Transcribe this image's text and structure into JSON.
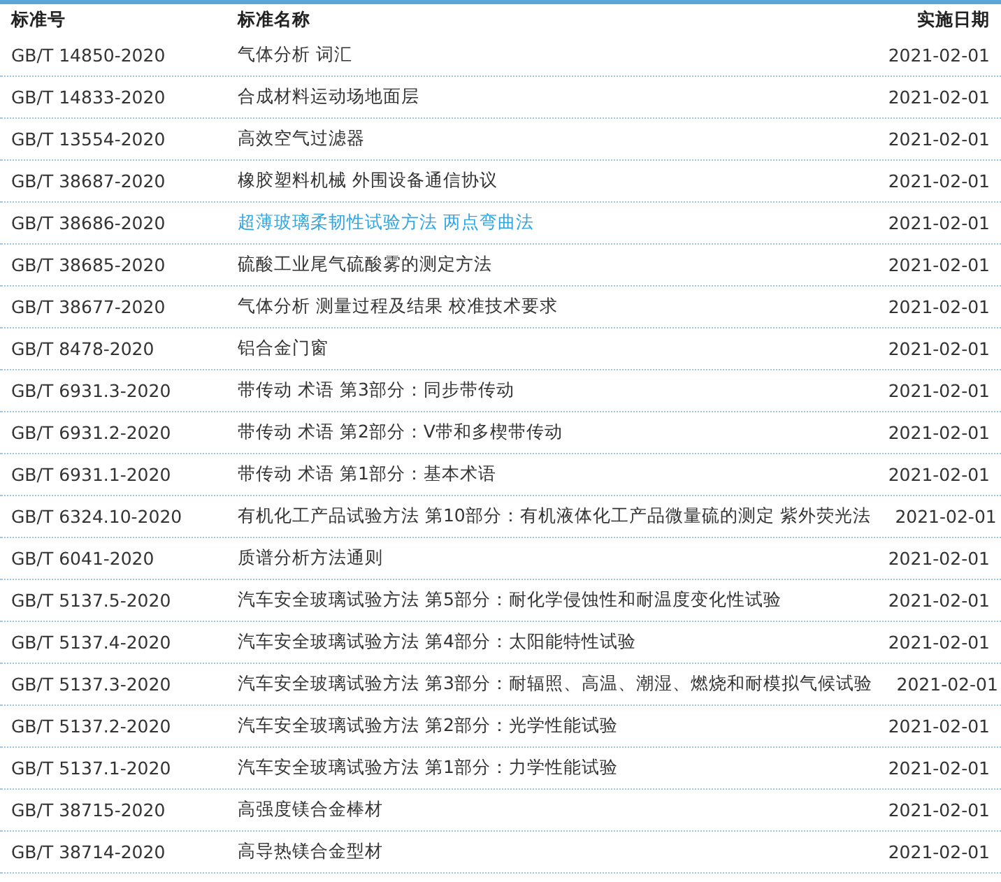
{
  "table": {
    "columns": [
      "标准号",
      "标准名称",
      "实施日期"
    ],
    "rows": [
      {
        "code": "GB/T 14850-2020",
        "name": "气体分析 词汇",
        "date": "2021-02-01",
        "hovered": false
      },
      {
        "code": "GB/T 14833-2020",
        "name": "合成材料运动场地面层",
        "date": "2021-02-01",
        "hovered": false
      },
      {
        "code": "GB/T 13554-2020",
        "name": "高效空气过滤器",
        "date": "2021-02-01",
        "hovered": false
      },
      {
        "code": "GB/T 38687-2020",
        "name": "橡胶塑料机械 外围设备通信协议",
        "date": "2021-02-01",
        "hovered": false
      },
      {
        "code": "GB/T 38686-2020",
        "name": "超薄玻璃柔韧性试验方法 两点弯曲法",
        "date": "2021-02-01",
        "hovered": true
      },
      {
        "code": "GB/T 38685-2020",
        "name": "硫酸工业尾气硫酸雾的测定方法",
        "date": "2021-02-01",
        "hovered": false
      },
      {
        "code": "GB/T 38677-2020",
        "name": "气体分析 测量过程及结果 校准技术要求",
        "date": "2021-02-01",
        "hovered": false
      },
      {
        "code": "GB/T 8478-2020",
        "name": "铝合金门窗",
        "date": "2021-02-01",
        "hovered": false
      },
      {
        "code": "GB/T 6931.3-2020",
        "name": "带传动 术语 第3部分：同步带传动",
        "date": "2021-02-01",
        "hovered": false
      },
      {
        "code": "GB/T 6931.2-2020",
        "name": "带传动 术语 第2部分：V带和多楔带传动",
        "date": "2021-02-01",
        "hovered": false
      },
      {
        "code": "GB/T 6931.1-2020",
        "name": "带传动 术语 第1部分：基本术语",
        "date": "2021-02-01",
        "hovered": false
      },
      {
        "code": "GB/T 6324.10-2020",
        "name": "有机化工产品试验方法 第10部分：有机液体化工产品微量硫的测定 紫外荧光法",
        "date": "2021-02-01",
        "hovered": false
      },
      {
        "code": "GB/T 6041-2020",
        "name": "质谱分析方法通则",
        "date": "2021-02-01",
        "hovered": false
      },
      {
        "code": "GB/T 5137.5-2020",
        "name": "汽车安全玻璃试验方法 第5部分：耐化学侵蚀性和耐温度变化性试验",
        "date": "2021-02-01",
        "hovered": false
      },
      {
        "code": "GB/T 5137.4-2020",
        "name": "汽车安全玻璃试验方法 第4部分：太阳能特性试验",
        "date": "2021-02-01",
        "hovered": false
      },
      {
        "code": "GB/T 5137.3-2020",
        "name": "汽车安全玻璃试验方法 第3部分：耐辐照、高温、潮湿、燃烧和耐模拟气候试验",
        "date": "2021-02-01",
        "hovered": false
      },
      {
        "code": "GB/T 5137.2-2020",
        "name": "汽车安全玻璃试验方法 第2部分：光学性能试验",
        "date": "2021-02-01",
        "hovered": false
      },
      {
        "code": "GB/T 5137.1-2020",
        "name": "汽车安全玻璃试验方法 第1部分：力学性能试验",
        "date": "2021-02-01",
        "hovered": false
      },
      {
        "code": "GB/T 38715-2020",
        "name": "高强度镁合金棒材",
        "date": "2021-02-01",
        "hovered": false
      },
      {
        "code": "GB/T 38714-2020",
        "name": "高导热镁合金型材",
        "date": "2021-02-01",
        "hovered": false
      }
    ]
  }
}
